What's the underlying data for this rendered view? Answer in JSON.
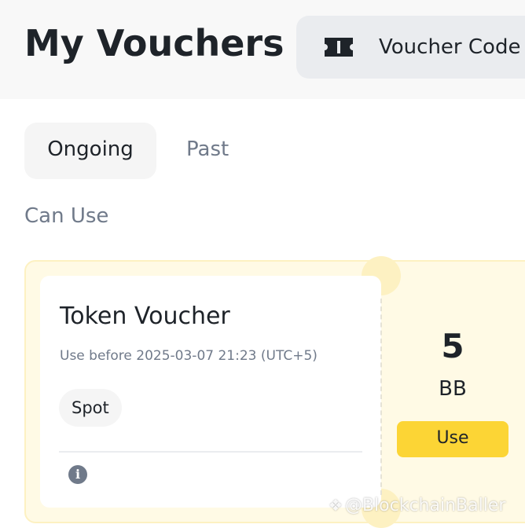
{
  "header": {
    "title": "My Vouchers",
    "voucher_code_button": {
      "label": "Voucher Code",
      "icon": "ticket-icon"
    }
  },
  "tabs": [
    {
      "label": "Ongoing",
      "active": true
    },
    {
      "label": "Past",
      "active": false
    }
  ],
  "section": {
    "label": "Can Use"
  },
  "voucher": {
    "title": "Token Voucher",
    "expiry": "Use before 2025-03-07 21:23 (UTC+5)",
    "tag": "Spot",
    "info_icon": "info-icon",
    "amount": "5",
    "currency": "BB",
    "use_label": "Use"
  },
  "watermark": {
    "text": "@BlockchainBaller",
    "icon": "binance-square-icon"
  },
  "colors": {
    "accent": "#fcd535",
    "voucher_background": "#fffae5",
    "text_primary": "#1e2329",
    "text_secondary": "#707a8a"
  }
}
